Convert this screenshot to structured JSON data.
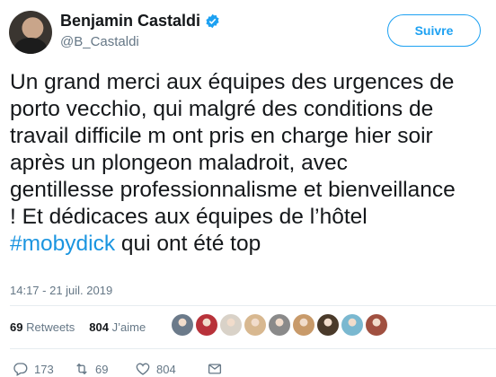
{
  "author": {
    "name": "Benjamin Castaldi",
    "handle": "@B_Castaldi",
    "verified": true
  },
  "follow_label": "Suivre",
  "tweet": {
    "lines": [
      "Un grand merci aux équipes des urgences de",
      "porto vecchio, qui malgré des conditions de",
      "travail difficile m ont pris en charge hier soir",
      "après un plongeon maladroit, avec",
      "gentillesse professionnalisme et bienveillance",
      "! Et dédicaces aux équipes de l’hôtel"
    ],
    "hashtag": "#mobydick",
    "last_line_rest": " qui ont été top"
  },
  "timestamp": "14:17 - 21 juil. 2019",
  "stats": {
    "retweets_count": "69",
    "retweets_label": "Retweets",
    "likes_count": "804",
    "likes_label": "J’aime"
  },
  "likers": [
    "#6b7a8a",
    "#b8323a",
    "#d9d2c8",
    "#d8b890",
    "#8a8a8a",
    "#c89a6a",
    "#4a3a2a",
    "#7ab8d0",
    "#a05040"
  ],
  "actions": {
    "replies": "173",
    "retweets": "69",
    "likes": "804"
  },
  "colors": {
    "accent": "#1da1f2",
    "hashtag": "#1b95e0",
    "secondary_text": "#657786"
  },
  "icons": [
    "verified-badge-icon",
    "reply-icon",
    "retweet-icon",
    "heart-icon",
    "message-icon"
  ]
}
